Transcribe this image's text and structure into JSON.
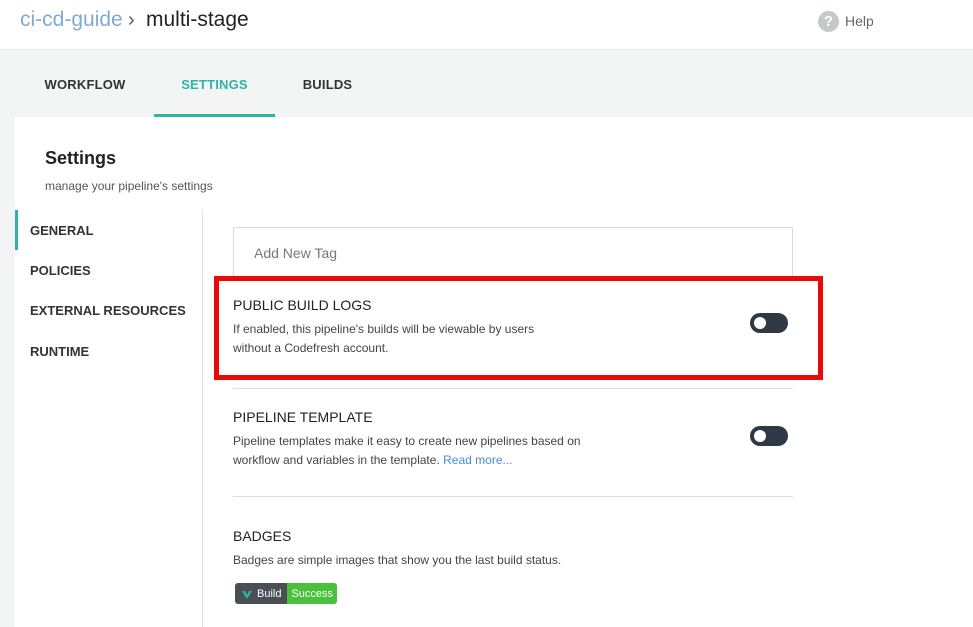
{
  "breadcrumb": {
    "project": "ci-cd-guide",
    "separator": "›",
    "pipeline": "multi-stage"
  },
  "help": {
    "icon": "question-circle-icon",
    "icon_glyph": "?",
    "label": "Help"
  },
  "tabs": [
    {
      "label": "WORKFLOW",
      "active": false
    },
    {
      "label": "SETTINGS",
      "active": true
    },
    {
      "label": "BUILDS",
      "active": false
    }
  ],
  "settings": {
    "title": "Settings",
    "subtitle": "manage your pipeline's settings"
  },
  "sidenav": [
    {
      "label": "GENERAL",
      "active": true
    },
    {
      "label": "POLICIES",
      "active": false
    },
    {
      "label": "EXTERNAL RESOURCES",
      "active": false
    },
    {
      "label": "RUNTIME",
      "active": false
    }
  ],
  "tag_input": {
    "placeholder": "Add New Tag",
    "value": ""
  },
  "public_build_logs": {
    "title": "PUBLIC BUILD LOGS",
    "description": "If enabled, this pipeline's builds will be viewable by users without a Codefresh account.",
    "enabled": false
  },
  "pipeline_template": {
    "title": "PIPELINE TEMPLATE",
    "description": "Pipeline templates make it easy to create new pipelines based on workflow and variables in the template.",
    "link": "Read more...",
    "enabled": false
  },
  "badges": {
    "title": "BADGES",
    "description": "Badges are simple images that show you the last build status.",
    "badge_left": "Build",
    "badge_right": "Success",
    "badge_logo": "codefresh-logo-icon"
  },
  "colors": {
    "accent": "#2eb3a6",
    "highlight_border": "#e8090b",
    "toggle_off": "#2e3945",
    "badge_success": "#49c13a",
    "link": "#4a8ad6"
  }
}
